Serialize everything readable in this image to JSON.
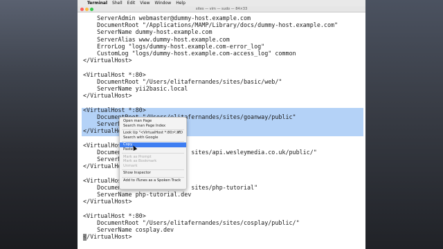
{
  "menubar": {
    "apple_glyph": "",
    "items": [
      "Terminal",
      "Shell",
      "Edit",
      "View",
      "Window",
      "Help"
    ]
  },
  "window": {
    "title": "sites — vim — sudo — 84×33"
  },
  "terminal": {
    "lines": [
      "    ServerAdmin webmaster@dummy-host.example.com",
      "    DocumentRoot \"/Applications/MAMP/Library/docs/dummy-host.example.com\"",
      "    ServerName dummy-host.example.com",
      "    ServerAlias www.dummy-host.example.com",
      "    ErrorLog \"logs/dummy-host.example.com-error_log\"",
      "    CustomLog \"logs/dummy-host.example.com-access_log\" common",
      "</VirtualHost>",
      "",
      "<VirtualHost *:80>",
      "    DocumentRoot \"/Users/elitafernandes/sites/basic/web/\"",
      "    ServerName yii2basic.local",
      "</VirtualHost>",
      "",
      "<VirtualHost *:80>",
      "    DocumentRoot \"/Users/elitafernandes/sites/goanway/public\"",
      "    ServerNa",
      "</VirtualHost>",
      "",
      "<VirtualHost *:80>",
      "    Documen                    sites/api.wesleymedia.co.uk/public/\"",
      "    ServerNa",
      "</VirtualHost>",
      "",
      "<VirtualHost *:80>",
      "    Documen                    sites/php-tutorial\"",
      "    ServerName php-tutorial.dev",
      "</VirtualHost>",
      "",
      "<VirtualHost *:80>",
      "    DocumentRoot \"/Users/elitafernandes/sites/cosplay/public/\"",
      "    ServerName cosplay.dev",
      "</VirtualHost>"
    ]
  },
  "context_menu": {
    "items": [
      {
        "label": "Open man Page",
        "disabled": false,
        "highlighted": false
      },
      {
        "label": "Search man Page Index",
        "disabled": false,
        "highlighted": false
      },
      {
        "separator": true
      },
      {
        "label": "Look Up \"<VirtualHost *:80>…\"",
        "shortcut": "⌃⌘D",
        "disabled": false,
        "highlighted": false
      },
      {
        "label": "Search with Google",
        "disabled": false,
        "highlighted": false
      },
      {
        "separator": true
      },
      {
        "label": "Copy",
        "disabled": false,
        "highlighted": true
      },
      {
        "label": "Paste",
        "disabled": false,
        "highlighted": false
      },
      {
        "separator": true
      },
      {
        "label": "Mark as Prompt",
        "disabled": true,
        "highlighted": false
      },
      {
        "label": "Mark as Bookmark",
        "disabled": true,
        "highlighted": false
      },
      {
        "label": "Unmark",
        "disabled": true,
        "highlighted": false
      },
      {
        "separator": true
      },
      {
        "label": "Show Inspector",
        "disabled": false,
        "highlighted": false
      },
      {
        "separator": true
      },
      {
        "label": "Add to iTunes as a Spoken Track",
        "disabled": false,
        "highlighted": false
      }
    ]
  },
  "colors": {
    "selection": "#b4d2f7",
    "menu_highlight": "#3e7ef2"
  }
}
